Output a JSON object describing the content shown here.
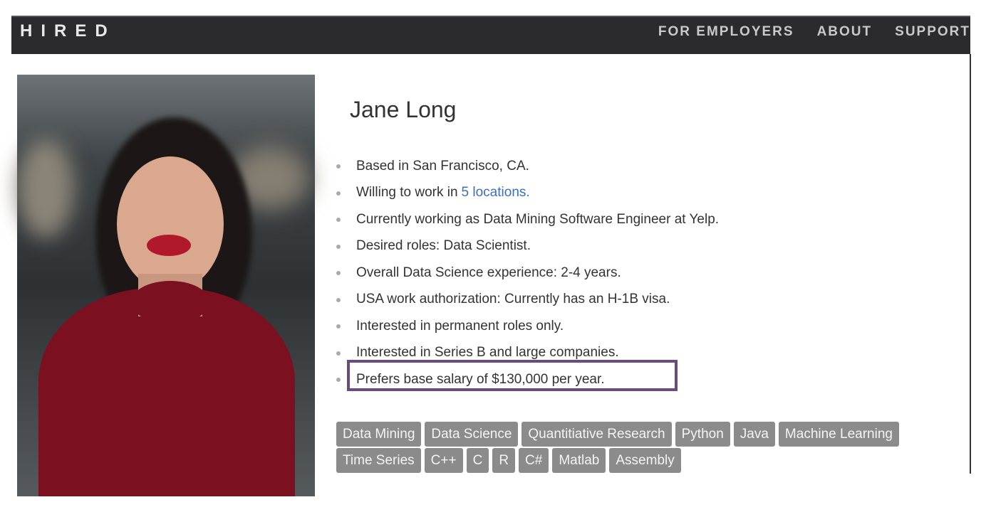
{
  "nav": {
    "logo": "HIRED",
    "links": [
      "FOR EMPLOYERS",
      "ABOUT",
      "SUPPORT"
    ]
  },
  "profile": {
    "name": "Jane Long",
    "facts": [
      {
        "text": "Based in San Francisco, CA."
      },
      {
        "text": "Willing to work in",
        "link": "5 locations."
      },
      {
        "text": "Currently working as Data Mining Software Engineer at Yelp."
      },
      {
        "text": "Desired roles: Data Scientist."
      },
      {
        "text": "Overall Data Science experience: 2-4 years."
      },
      {
        "text": "USA work authorization: Currently has an H-1B visa."
      },
      {
        "text": "Interested in permanent roles only."
      },
      {
        "text": "Interested in Series B and large companies."
      },
      {
        "text": "Prefers base salary of $130,000 per year."
      }
    ],
    "highlight_color": "#6b4a7e",
    "skills": [
      "Data Mining",
      "Data Science",
      "Quantitiative Research",
      "Python",
      "Java",
      "Machine Learning",
      "Time Series",
      "C++",
      "C",
      "R",
      "C#",
      "Matlab",
      "Assembly"
    ]
  }
}
